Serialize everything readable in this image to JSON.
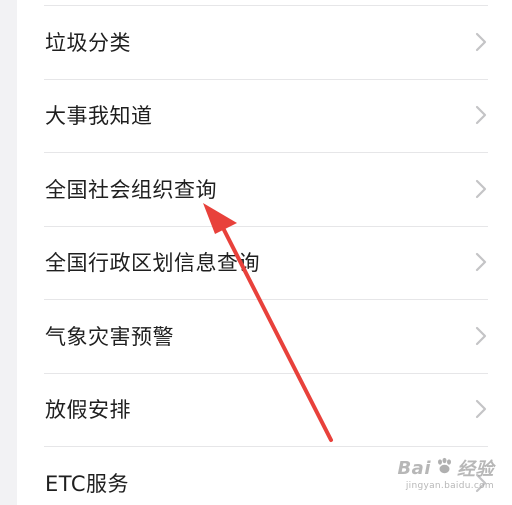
{
  "menu": {
    "items": [
      {
        "label": "垃圾分类"
      },
      {
        "label": "大事我知道"
      },
      {
        "label": "全国社会组织查询"
      },
      {
        "label": "全国行政区划信息查询"
      },
      {
        "label": "气象灾害预警"
      },
      {
        "label": "放假安排"
      },
      {
        "label": "ETC服务"
      }
    ]
  },
  "watermark": {
    "brand": "Bai",
    "brand_cn": "经验",
    "url": "jingyan.baidu.com"
  },
  "colors": {
    "background": "#f2f2f4",
    "card": "#ffffff",
    "text": "#1f1f1f",
    "divider": "#e6e6e8",
    "chevron": "#c4c4c6",
    "annotation_arrow": "#e8413b"
  }
}
